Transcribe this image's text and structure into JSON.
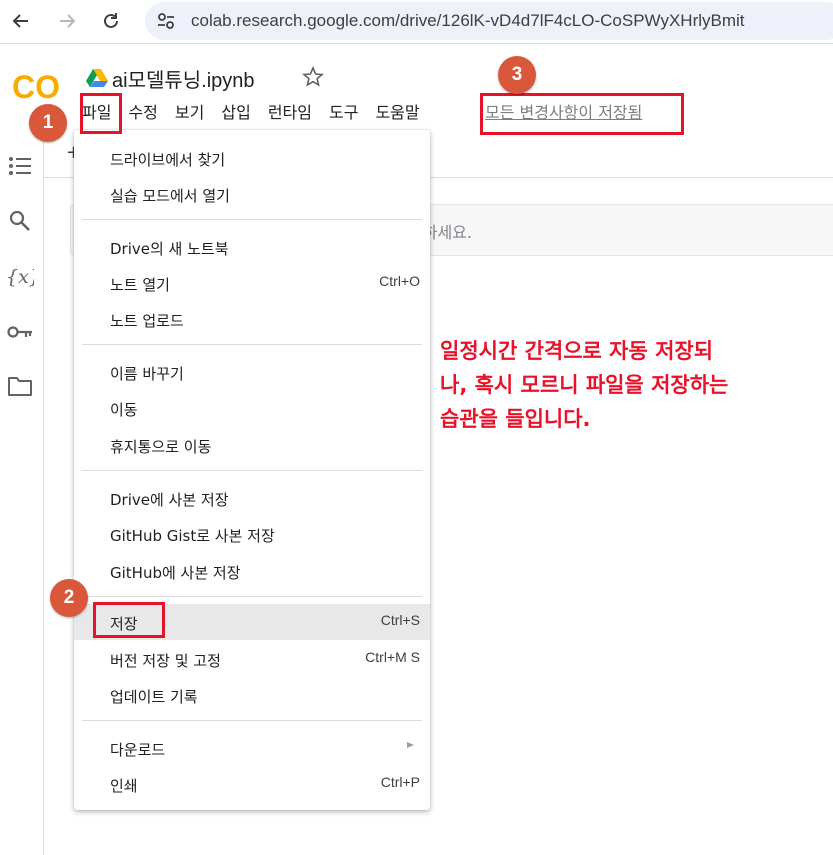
{
  "browser": {
    "url": "colab.research.google.com/drive/126lK-vD4d7lF4cLO-CoSPWyXHrlyBmit"
  },
  "colab": {
    "logo_text": "CO",
    "notebook_title": "ai모델튜닝.ipynb",
    "menubar": [
      "파일",
      "수정",
      "보기",
      "삽입",
      "런타임",
      "도구",
      "도움말"
    ],
    "saved_status": "모든 변경사항이 저장됨",
    "toolbar_fragment": "+",
    "cell_placeholder": "력하세요.",
    "rail_icons": [
      "toc-icon",
      "search-icon",
      "variables-icon",
      "key-icon",
      "folder-icon"
    ]
  },
  "file_menu": {
    "items": [
      {
        "label": "드라이브에서 찾기",
        "shortcut": ""
      },
      {
        "label": "실습 모드에서 열기",
        "shortcut": ""
      },
      {
        "label": "Drive의 새 노트북",
        "shortcut": ""
      },
      {
        "label": "노트 열기",
        "shortcut": "Ctrl+O"
      },
      {
        "label": "노트 업로드",
        "shortcut": ""
      },
      {
        "label": "이름 바꾸기",
        "shortcut": ""
      },
      {
        "label": "이동",
        "shortcut": ""
      },
      {
        "label": "휴지통으로 이동",
        "shortcut": ""
      },
      {
        "label": "Drive에 사본 저장",
        "shortcut": ""
      },
      {
        "label": "GitHub Gist로 사본 저장",
        "shortcut": ""
      },
      {
        "label": "GitHub에 사본 저장",
        "shortcut": ""
      },
      {
        "label": "저장",
        "shortcut": "Ctrl+S"
      },
      {
        "label": "버전 저장 및 고정",
        "shortcut": "Ctrl+M S"
      },
      {
        "label": "업데이트 기록",
        "shortcut": ""
      },
      {
        "label": "다운로드",
        "shortcut": ""
      },
      {
        "label": "인쇄",
        "shortcut": "Ctrl+P"
      }
    ]
  },
  "annotations": {
    "badges": [
      "1",
      "2",
      "3"
    ],
    "note_lines": [
      "일정시간 간격으로 자동 저장되",
      "나, 혹시 모르니 파일을 저장하는",
      "습관을 들입니다."
    ],
    "highlight_color": "#e8132a",
    "badge_color": "#d9573a"
  }
}
